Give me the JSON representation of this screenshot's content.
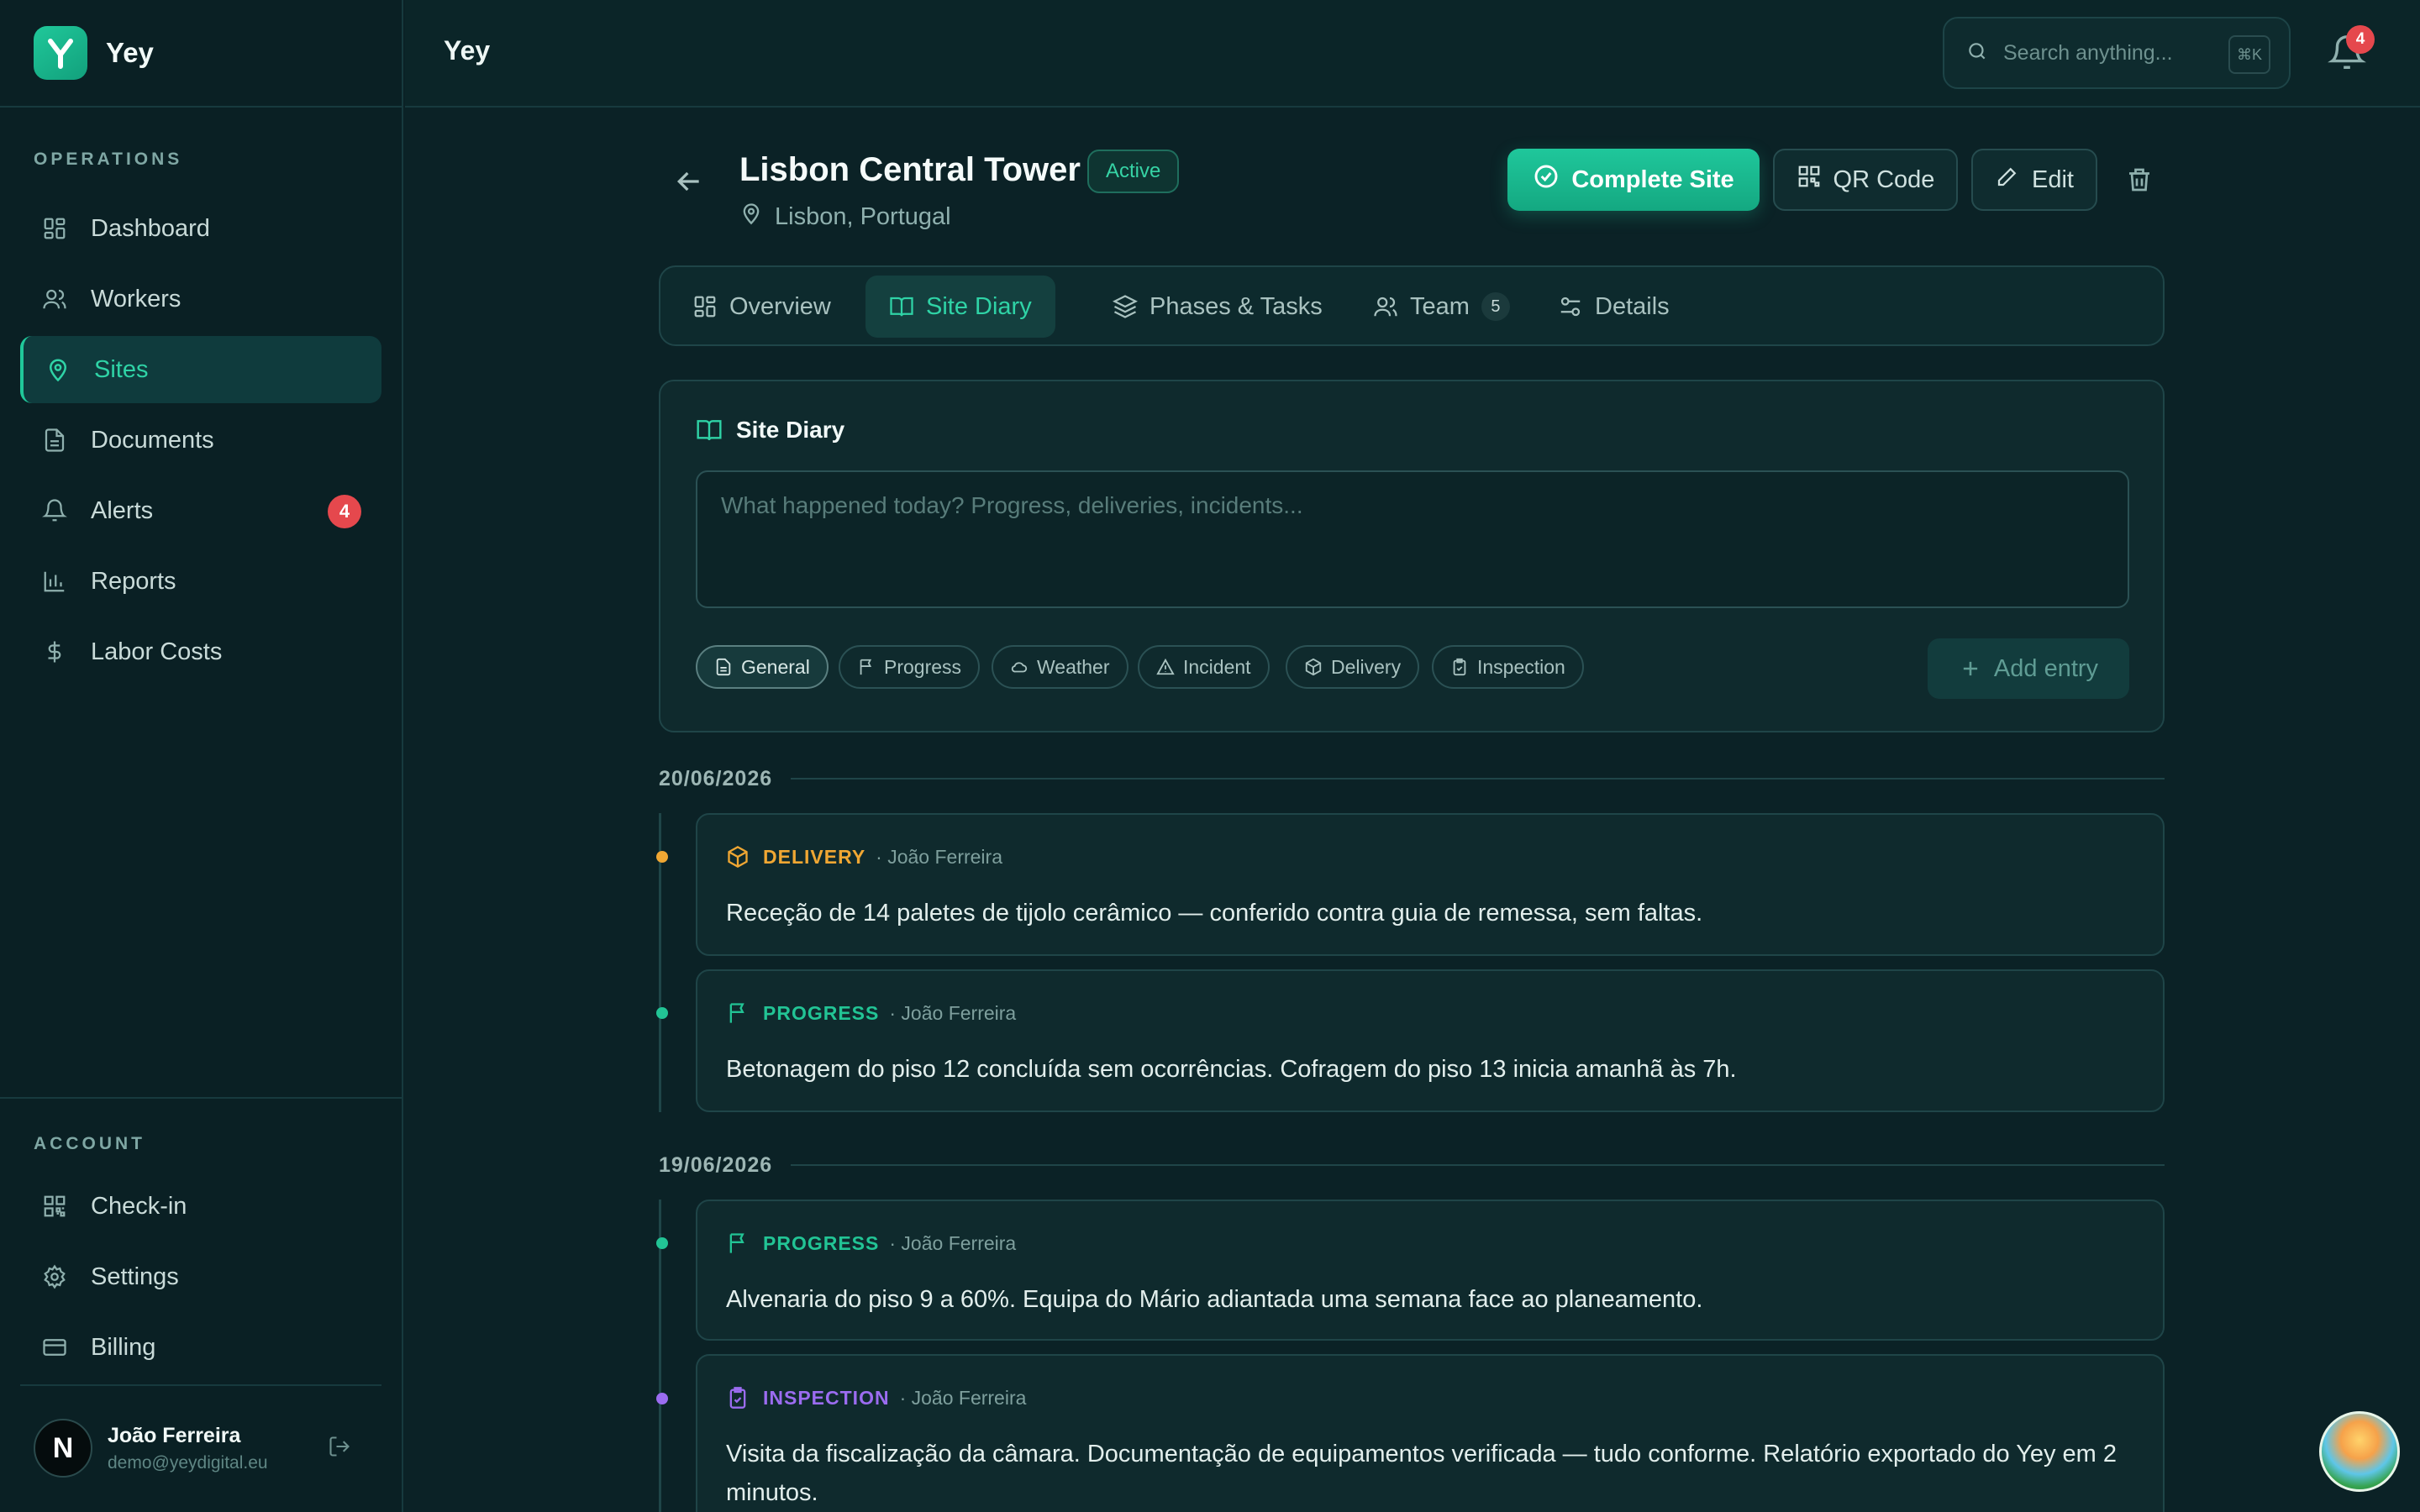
{
  "app": {
    "brand_name": "Yey",
    "brand_initial": "Y",
    "page_header": "Yey"
  },
  "sidebar": {
    "operations_label": "OPERATIONS",
    "items": [
      {
        "label": "Dashboard",
        "icon": "dashboard-icon"
      },
      {
        "label": "Workers",
        "icon": "users-icon"
      },
      {
        "label": "Sites",
        "icon": "map-pin-icon",
        "active": true
      },
      {
        "label": "Documents",
        "icon": "document-icon"
      },
      {
        "label": "Alerts",
        "icon": "bell-icon",
        "badge": "4"
      },
      {
        "label": "Reports",
        "icon": "bar-chart-icon"
      },
      {
        "label": "Labor Costs",
        "icon": "dollar-icon"
      }
    ],
    "account_label": "ACCOUNT",
    "account_items": [
      {
        "label": "Check-in",
        "icon": "qr-code-icon"
      },
      {
        "label": "Settings",
        "icon": "gear-icon"
      },
      {
        "label": "Billing",
        "icon": "credit-card-icon"
      }
    ],
    "user": {
      "initial": "N",
      "name": "João Ferreira",
      "email": "demo@yeydigital.eu"
    }
  },
  "topbar": {
    "search_placeholder": "Search anything...",
    "shortcut": "⌘K",
    "notification_count": "4"
  },
  "site": {
    "name": "Lisbon Central Tower",
    "status": "Active",
    "location": "Lisbon, Portugal",
    "actions": {
      "complete": "Complete Site",
      "qr": "QR Code",
      "edit": "Edit"
    }
  },
  "tabs": [
    {
      "label": "Overview"
    },
    {
      "label": "Site Diary",
      "active": true
    },
    {
      "label": "Phases & Tasks"
    },
    {
      "label": "Team",
      "count": "5"
    },
    {
      "label": "Details"
    }
  ],
  "diary": {
    "title": "Site Diary",
    "placeholder": "What happened today? Progress, deliveries, incidents...",
    "categories": [
      "General",
      "Progress",
      "Weather",
      "Incident",
      "Delivery",
      "Inspection"
    ],
    "selected_category": "General",
    "add_button": "Add entry"
  },
  "entries": {
    "day1": {
      "date": "20/06/2026",
      "items": [
        {
          "type": "DELIVERY",
          "author": "· João Ferreira",
          "color": "#f0a733",
          "text": "Receção de 14 paletes de tijolo cerâmico — conferido contra guia de remessa, sem faltas."
        },
        {
          "type": "PROGRESS",
          "author": "· João Ferreira",
          "color": "#22c495",
          "text": "Betonagem do piso 12 concluída sem ocorrências. Cofragem do piso 13 inicia amanhã às 7h."
        }
      ]
    },
    "day2": {
      "date": "19/06/2026",
      "items": [
        {
          "type": "PROGRESS",
          "author": "· João Ferreira",
          "color": "#22c495",
          "text": "Alvenaria do piso 9 a 60%. Equipa do Mário adiantada uma semana face ao planeamento."
        },
        {
          "type": "INSPECTION",
          "author": "· João Ferreira",
          "color": "#9b6cf0",
          "text": "Visita da fiscalização da câmara. Documentação de equipamentos verificada — tudo conforme. Relatório exportado do Yey em 2 minutos."
        }
      ]
    }
  },
  "colors": {
    "accent": "#20c89a",
    "background": "#0b2226",
    "danger": "#e5484d"
  }
}
